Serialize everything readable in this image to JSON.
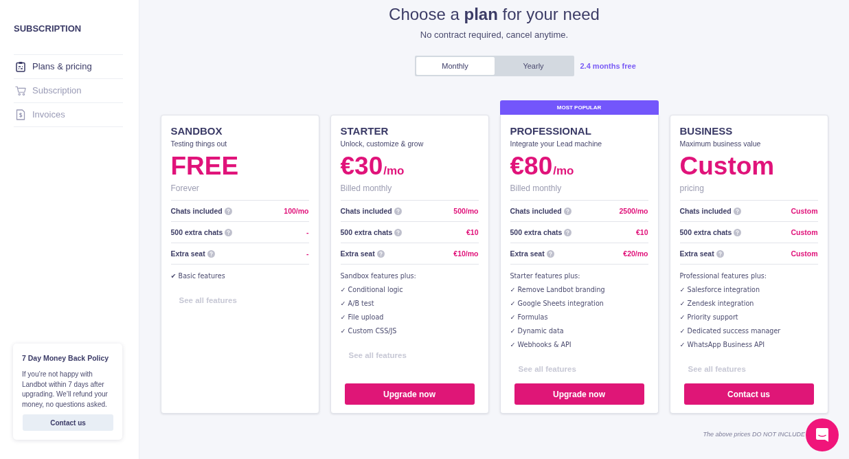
{
  "sidebar": {
    "title": "SUBSCRIPTION",
    "items": [
      {
        "label": "Plans & pricing",
        "selected": true
      },
      {
        "label": "Subscription",
        "selected": false
      },
      {
        "label": "Invoices",
        "selected": false
      }
    ],
    "policy": {
      "title": "7 Day Money Back Policy",
      "text": "If you’re not happy with Landbot within 7 days after upgrading. We’ll refund your money, no questions asked.",
      "button": "Contact us"
    }
  },
  "header": {
    "title": "Choose a **plan** for your need",
    "subtitle": "No contract required, cancel anytime."
  },
  "billing_toggle": {
    "options": [
      {
        "label": "Monthly",
        "selected": true
      },
      {
        "label": "Yearly",
        "selected": false
      }
    ],
    "note": "2.4 months free"
  },
  "plans": [
    {
      "name": "SANDBOX",
      "tagline": "Testing things out",
      "price": "FREE",
      "period": "Forever",
      "limits": [
        {
          "label": "Chats included",
          "value": "100/mo"
        },
        {
          "label": "500 extra chats",
          "value": "-"
        },
        {
          "label": "Extra seat",
          "value": "-"
        }
      ],
      "features": [
        "✔ Basic features"
      ],
      "see_all": "See all features"
    },
    {
      "name": "STARTER",
      "tagline": "Unlock, customize & grow",
      "price": "€30",
      "unit": "/mo",
      "period": "Billed monthly",
      "limits": [
        {
          "label": "Chats included",
          "value": "500/mo"
        },
        {
          "label": "500 extra chats",
          "value": "€10"
        },
        {
          "label": "Extra seat",
          "value": "€10/mo"
        }
      ],
      "features_intro": "Sandbox features plus:",
      "features": [
        "✓ Conditional logic",
        "✓ A/B test",
        "✓ File upload",
        "✓ Custom CSS/JS"
      ],
      "see_all": "See all features",
      "button": "Upgrade now"
    },
    {
      "badge": "MOST POPULAR",
      "name": "PROFESSIONAL",
      "tagline": "Integrate your Lead machine",
      "price": "€80",
      "unit": "/mo",
      "period": "Billed monthly",
      "limits": [
        {
          "label": "Chats included",
          "value": "2500/mo"
        },
        {
          "label": "500 extra chats",
          "value": "€10"
        },
        {
          "label": "Extra seat",
          "value": "€20/mo"
        }
      ],
      "features_intro": "Starter features plus:",
      "features": [
        "✓ Remove Landbot branding",
        "✓ Google Sheets integration",
        "✓ Formulas",
        "✓ Dynamic data",
        "✓ Webhooks & API"
      ],
      "see_all": "See all features",
      "button": "Upgrade now"
    },
    {
      "name": "BUSINESS",
      "tagline": "Maximum business value",
      "price": "Custom",
      "period": "pricing",
      "limits": [
        {
          "label": "Chats included",
          "value": "Custom"
        },
        {
          "label": "500 extra chats",
          "value": "Custom"
        },
        {
          "label": "Extra seat",
          "value": "Custom"
        }
      ],
      "features_intro": "Professional features plus:",
      "features": [
        "✓ Salesforce integration",
        "✓ Zendesk integration",
        "✓ Priority support",
        "✓ Dedicated success manager",
        "✓ WhatsApp Business API"
      ],
      "see_all": "See all features",
      "button": "Contact us"
    }
  ],
  "footer_note": "The above prices DO NOT INCLUDE"
}
